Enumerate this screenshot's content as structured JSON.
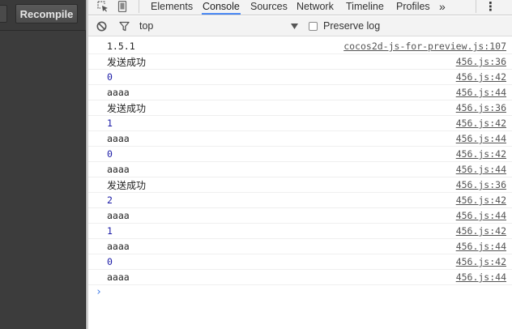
{
  "editor": {
    "recompile_label": "Recompile"
  },
  "devtools": {
    "tabs": [
      "Elements",
      "Console",
      "Sources",
      "Network",
      "Timeline",
      "Profiles"
    ],
    "active_tab": "Console",
    "overflow_glyph": "»",
    "menu_glyph": "⋮"
  },
  "filter": {
    "context": "top",
    "preserve_log_label": "Preserve log",
    "preserve_log_checked": false
  },
  "console": {
    "rows": [
      {
        "text": "1.5.1",
        "kind": "text",
        "source": "cocos2d-js-for-preview.js:107"
      },
      {
        "text": "发送成功",
        "kind": "cjk",
        "source": "456.js:36"
      },
      {
        "text": "0",
        "kind": "num",
        "source": "456.js:42"
      },
      {
        "text": "aaaa",
        "kind": "text",
        "source": "456.js:44"
      },
      {
        "text": "发送成功",
        "kind": "cjk",
        "source": "456.js:36"
      },
      {
        "text": "1",
        "kind": "num",
        "source": "456.js:42"
      },
      {
        "text": "aaaa",
        "kind": "text",
        "source": "456.js:44"
      },
      {
        "text": "0",
        "kind": "num",
        "source": "456.js:42"
      },
      {
        "text": "aaaa",
        "kind": "text",
        "source": "456.js:44"
      },
      {
        "text": "发送成功",
        "kind": "cjk",
        "source": "456.js:36"
      },
      {
        "text": "2",
        "kind": "num",
        "source": "456.js:42"
      },
      {
        "text": "aaaa",
        "kind": "text",
        "source": "456.js:44"
      },
      {
        "text": "1",
        "kind": "num",
        "source": "456.js:42"
      },
      {
        "text": "aaaa",
        "kind": "text",
        "source": "456.js:44"
      },
      {
        "text": "0",
        "kind": "num",
        "source": "456.js:42"
      },
      {
        "text": "aaaa",
        "kind": "text",
        "source": "456.js:44"
      }
    ],
    "prompt_glyph": "›"
  }
}
